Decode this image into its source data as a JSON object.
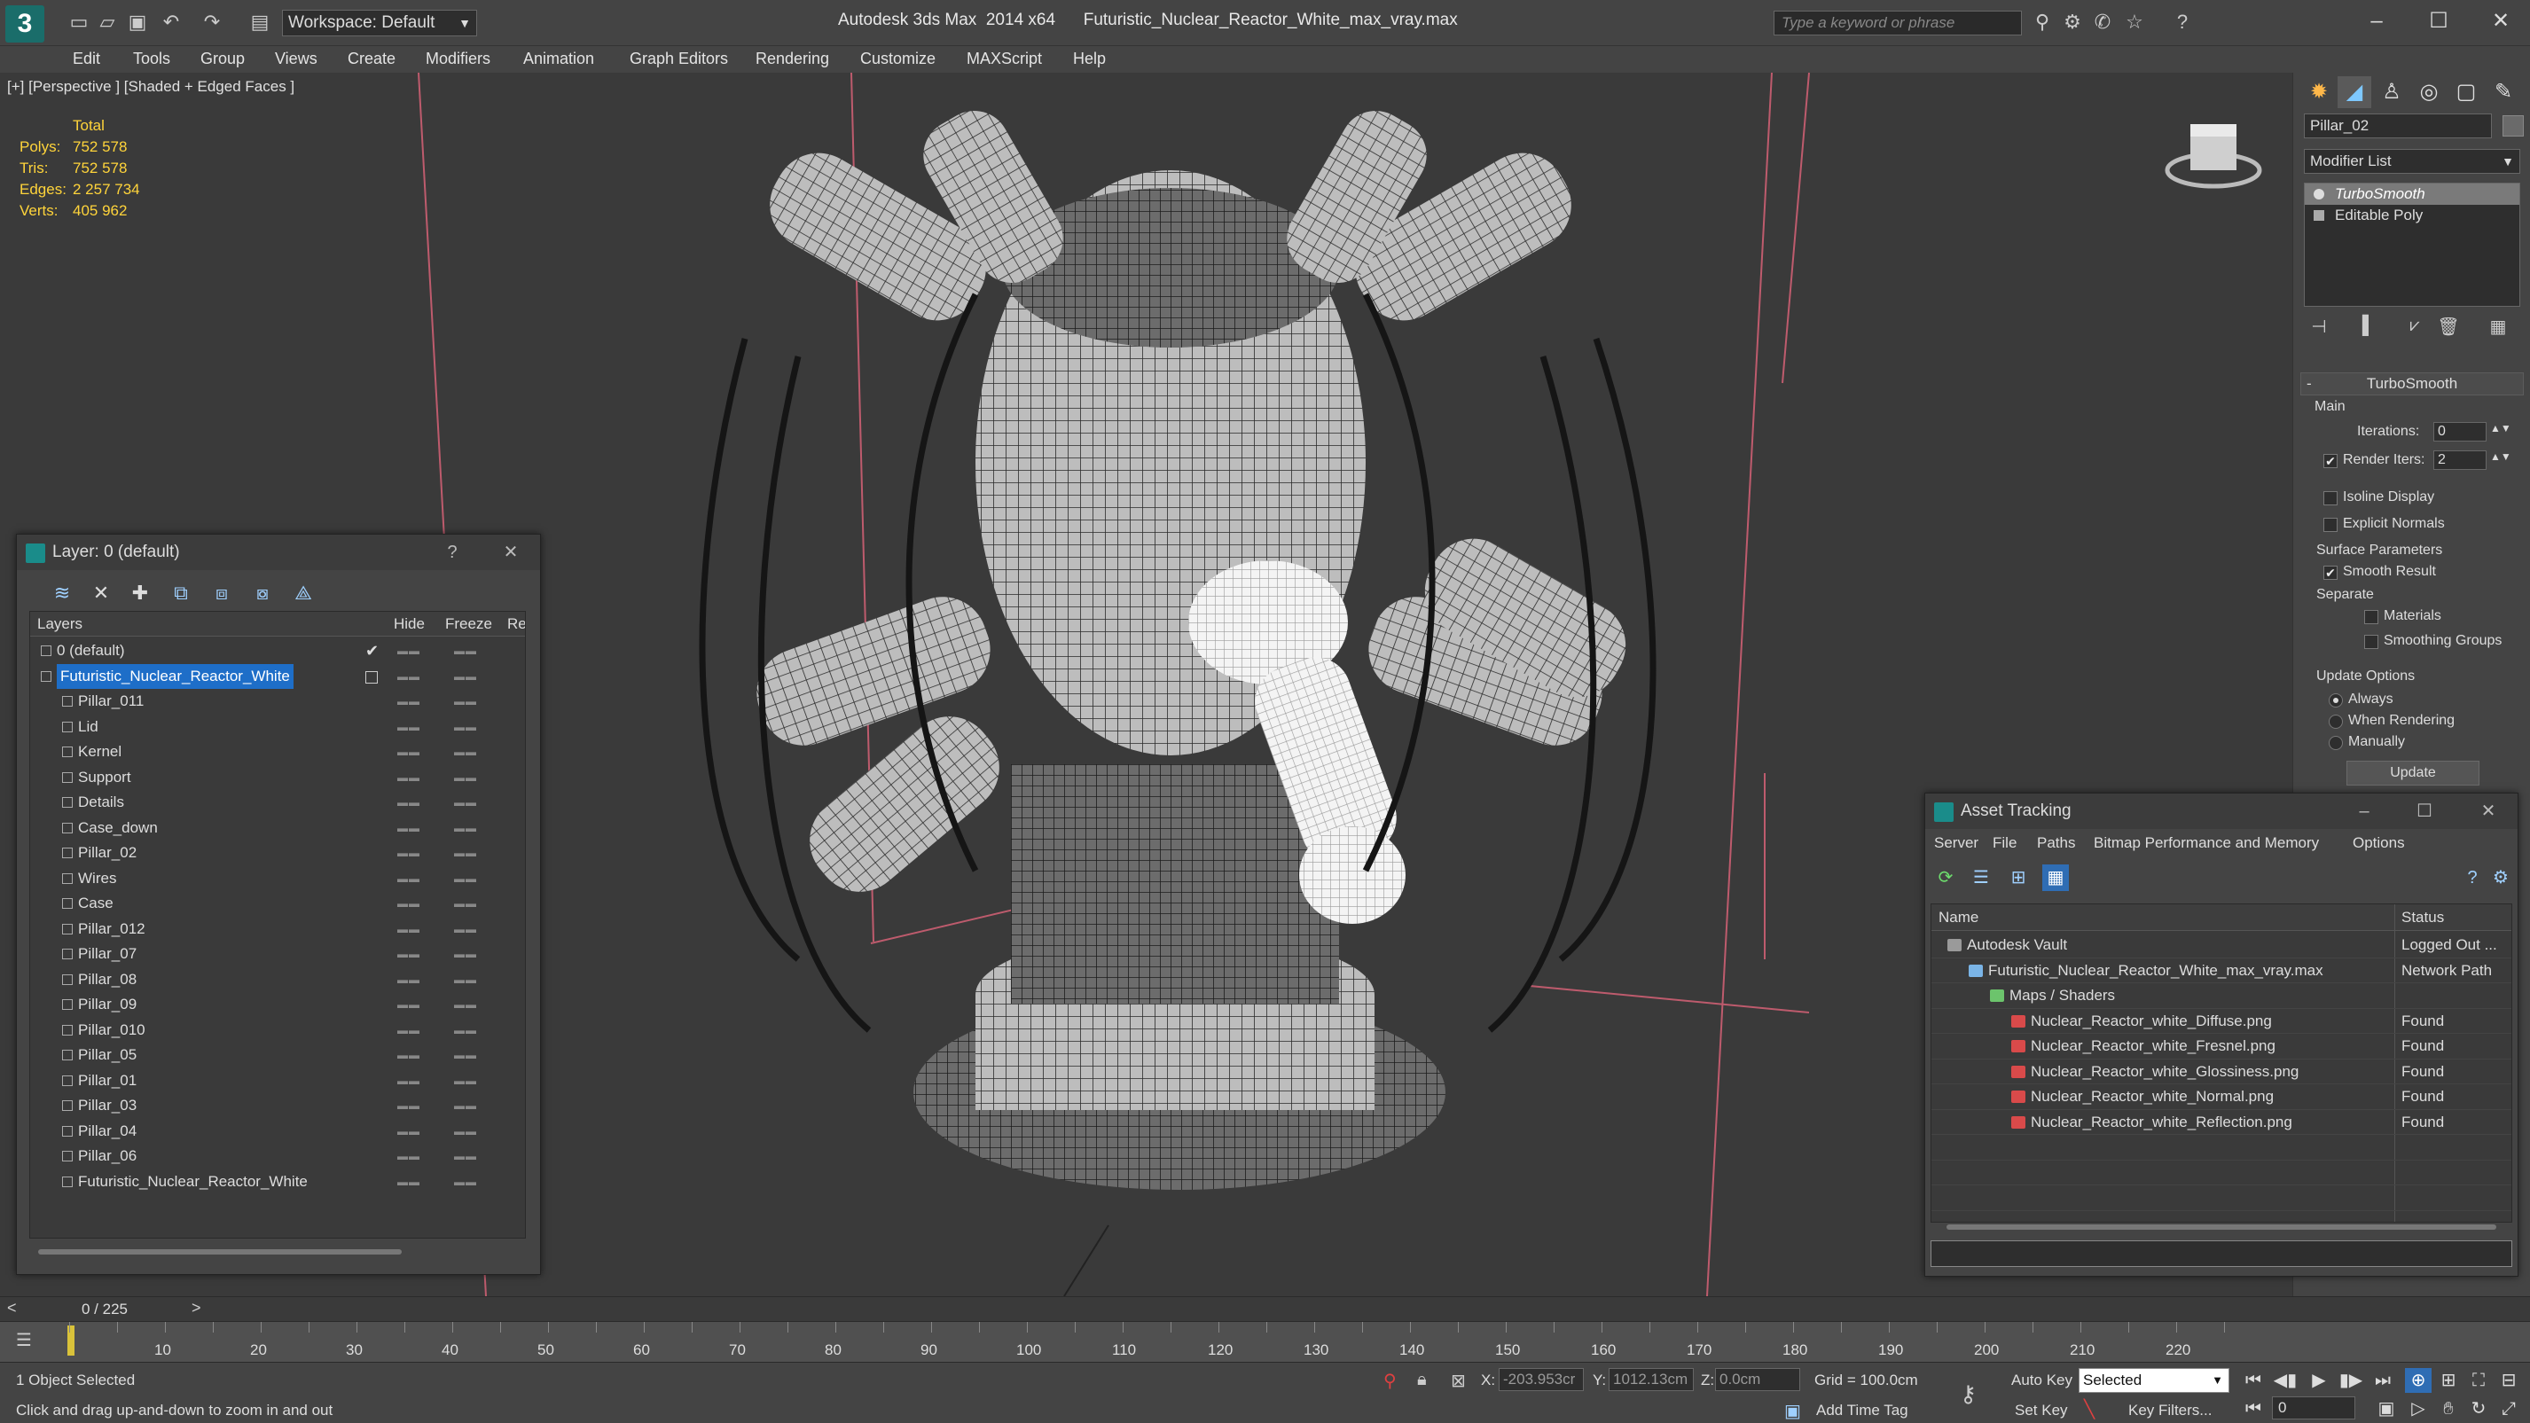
{
  "titlebar": {
    "workspace": "Workspace: Default",
    "title": "Autodesk 3ds Max  2014 x64      Futuristic_Nuclear_Reactor_White_max_vray.max",
    "search_placeholder": "Type a keyword or phrase"
  },
  "menu": [
    "Edit",
    "Tools",
    "Group",
    "Views",
    "Create",
    "Modifiers",
    "Animation",
    "Graph Editors",
    "Rendering",
    "Customize",
    "MAXScript",
    "Help"
  ],
  "viewport": {
    "label": "[+] [Perspective ] [Shaded + Edged Faces ]",
    "stats_header": "Total",
    "stats": [
      {
        "label": "Polys:",
        "value": "752 578"
      },
      {
        "label": "Tris:",
        "value": "752 578"
      },
      {
        "label": "Edges:",
        "value": "2 257 734"
      },
      {
        "label": "Verts:",
        "value": "405 962"
      }
    ]
  },
  "command_panel": {
    "object_name": "Pillar_02",
    "modifier_list": "Modifier List",
    "stack": [
      {
        "label": "TurboSmooth",
        "selected": true
      },
      {
        "label": "Editable Poly",
        "selected": false
      }
    ],
    "rollout_title": "TurboSmooth",
    "main_label": "Main",
    "iterations_label": "Iterations:",
    "iterations_value": "0",
    "render_iters_label": "Render Iters:",
    "render_iters_value": "2",
    "isoline_label": "Isoline Display",
    "explicit_normals_label": "Explicit Normals",
    "surface_params_label": "Surface Parameters",
    "smooth_result_label": "Smooth Result",
    "separate_label": "Separate",
    "materials_label": "Materials",
    "smoothing_groups_label": "Smoothing Groups",
    "update_options_label": "Update Options",
    "always_label": "Always",
    "when_rendering_label": "When Rendering",
    "manually_label": "Manually",
    "update_button": "Update"
  },
  "layer_dialog": {
    "title": "Layer: 0 (default)",
    "help": "?",
    "columns": {
      "layers": "Layers",
      "hide": "Hide",
      "freeze": "Freeze",
      "render": "Re"
    },
    "rows": [
      {
        "name": "0 (default)",
        "level": 0,
        "check": true,
        "selected": false
      },
      {
        "name": "Futuristic_Nuclear_Reactor_White",
        "level": 0,
        "check": false,
        "selected": true
      },
      {
        "name": "Pillar_011",
        "level": 1
      },
      {
        "name": "Lid",
        "level": 1
      },
      {
        "name": "Kernel",
        "level": 1
      },
      {
        "name": "Support",
        "level": 1
      },
      {
        "name": "Details",
        "level": 1
      },
      {
        "name": "Case_down",
        "level": 1
      },
      {
        "name": "Pillar_02",
        "level": 1
      },
      {
        "name": "Wires",
        "level": 1
      },
      {
        "name": "Case",
        "level": 1
      },
      {
        "name": "Pillar_012",
        "level": 1
      },
      {
        "name": "Pillar_07",
        "level": 1
      },
      {
        "name": "Pillar_08",
        "level": 1
      },
      {
        "name": "Pillar_09",
        "level": 1
      },
      {
        "name": "Pillar_010",
        "level": 1
      },
      {
        "name": "Pillar_05",
        "level": 1
      },
      {
        "name": "Pillar_01",
        "level": 1
      },
      {
        "name": "Pillar_03",
        "level": 1
      },
      {
        "name": "Pillar_04",
        "level": 1
      },
      {
        "name": "Pillar_06",
        "level": 1
      },
      {
        "name": "Futuristic_Nuclear_Reactor_White",
        "level": 1
      }
    ]
  },
  "asset_tracking": {
    "title": "Asset Tracking",
    "menu": [
      "Server",
      "File",
      "Paths",
      "Bitmap Performance and Memory",
      "Options"
    ],
    "columns": {
      "name": "Name",
      "status": "Status"
    },
    "rows": [
      {
        "name": "Autodesk Vault",
        "status": "Logged Out ...",
        "level": 0,
        "icon": "vault"
      },
      {
        "name": "Futuristic_Nuclear_Reactor_White_max_vray.max",
        "status": "Network Path",
        "level": 1,
        "icon": "file"
      },
      {
        "name": "Maps / Shaders",
        "status": "",
        "level": 2,
        "icon": "maps"
      },
      {
        "name": "Nuclear_Reactor_white_Diffuse.png",
        "status": "Found",
        "level": 3,
        "icon": "png"
      },
      {
        "name": "Nuclear_Reactor_white_Fresnel.png",
        "status": "Found",
        "level": 3,
        "icon": "png"
      },
      {
        "name": "Nuclear_Reactor_white_Glossiness.png",
        "status": "Found",
        "level": 3,
        "icon": "png"
      },
      {
        "name": "Nuclear_Reactor_white_Normal.png",
        "status": "Found",
        "level": 3,
        "icon": "png"
      },
      {
        "name": "Nuclear_Reactor_white_Reflection.png",
        "status": "Found",
        "level": 3,
        "icon": "png"
      }
    ]
  },
  "timeline": {
    "slider_label": "0 / 225",
    "ticks": [
      "10",
      "20",
      "30",
      "40",
      "50",
      "60",
      "70",
      "80",
      "90",
      "100",
      "110",
      "120",
      "130",
      "140",
      "150",
      "160",
      "170",
      "180",
      "190",
      "200",
      "210",
      "220"
    ]
  },
  "statusbar": {
    "selection": "1 Object Selected",
    "prompt": "Click and drag up-and-down to zoom in and out",
    "x_label": "X:",
    "x_value": "-203.953cr",
    "y_label": "Y:",
    "y_value": "1012.13cm",
    "z_label": "Z:",
    "z_value": "0.0cm",
    "grid": "Grid = 100.0cm",
    "auto_key": "Auto Key",
    "key_mode": "Selected",
    "set_key": "Set Key",
    "key_filters": "Key Filters...",
    "add_time_tag": "Add Time Tag",
    "frame": "0"
  },
  "colors": {
    "accent": "#1e6ec8",
    "stats_text": "#ffd43a",
    "viewport_bg": "#3a3a3a",
    "grid_line": "#e0647a"
  }
}
